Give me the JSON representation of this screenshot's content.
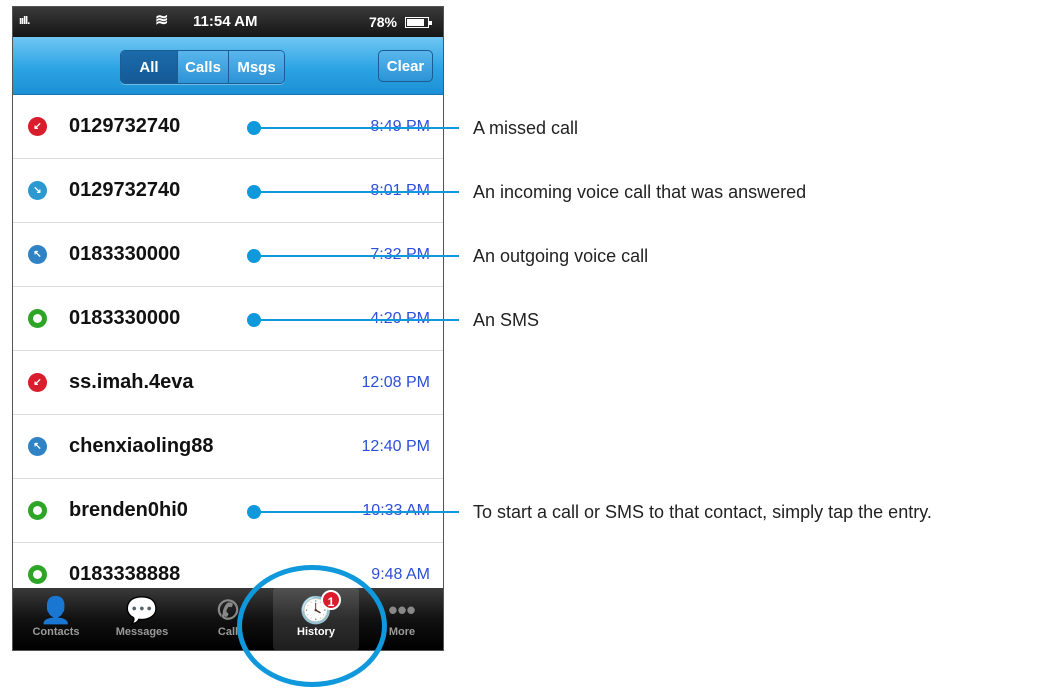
{
  "status": {
    "signal": "ııll.",
    "wifi": "≋",
    "time": "11:54 AM",
    "battery": "78%"
  },
  "toolbar": {
    "seg_all": "All",
    "seg_calls": "Calls",
    "seg_msgs": "Msgs",
    "clear": "Clear"
  },
  "rows": [
    {
      "icon": "missed-call-icon",
      "name": "0129732740",
      "time": "8:49 PM"
    },
    {
      "icon": "incoming-call-icon",
      "name": "0129732740",
      "time": "8:01 PM"
    },
    {
      "icon": "outgoing-call-icon",
      "name": "0183330000",
      "time": "7:32 PM"
    },
    {
      "icon": "sms-icon",
      "name": "0183330000",
      "time": "4:20 PM"
    },
    {
      "icon": "missed-call-icon",
      "name": "ss.imah.4eva",
      "time": "12:08 PM"
    },
    {
      "icon": "outgoing-call-icon",
      "name": "chenxiaoling88",
      "time": "12:40 PM"
    },
    {
      "icon": "sms-icon",
      "name": "brenden0hi0",
      "time": "10:33 AM"
    },
    {
      "icon": "sms-icon",
      "name": "0183338888",
      "time": "9:48 AM"
    }
  ],
  "tabs": [
    {
      "label": "Contacts",
      "icon": "contacts-icon"
    },
    {
      "label": "Messages",
      "icon": "messages-icon"
    },
    {
      "label": "Call",
      "icon": "phone-icon"
    },
    {
      "label": "History",
      "icon": "clock-icon",
      "badge": "1"
    },
    {
      "label": "More",
      "icon": "more-icon"
    }
  ],
  "annotations": {
    "missed": "A missed call",
    "incoming": "An incoming voice call that was answered",
    "outgoing": "An outgoing voice call",
    "sms": "An SMS",
    "tap": "To start a call or SMS to that contact, simply tap the entry."
  },
  "colors": {
    "accent": "#0f98db",
    "missed": "#d81d2c",
    "sms": "#2fa528",
    "time_text": "#2b4fd8"
  }
}
